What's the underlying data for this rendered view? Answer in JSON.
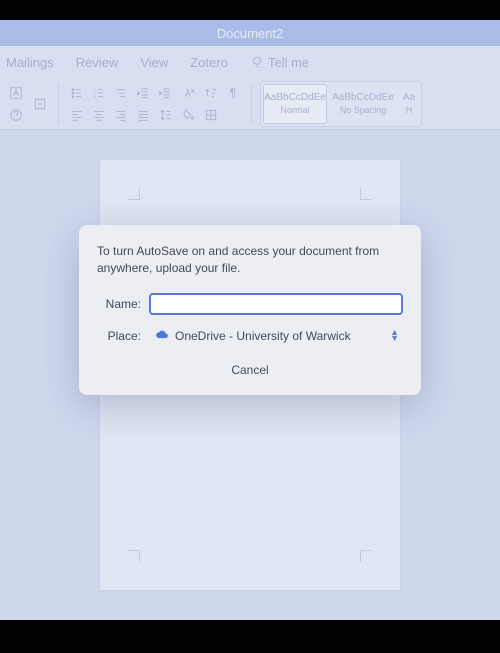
{
  "window": {
    "title": "Document2"
  },
  "ribbon": {
    "tabs": {
      "mailings": "Mailings",
      "review": "Review",
      "view": "View",
      "zotero": "Zotero",
      "tell_me": "Tell me"
    },
    "styles": {
      "normal": {
        "preview": "AaBbCcDdEe",
        "label": "Normal"
      },
      "no_spacing": {
        "preview": "AaBbCcDdEe",
        "label": "No Spacing"
      },
      "heading_cut": {
        "preview": "Aa",
        "label": "H"
      }
    }
  },
  "dialog": {
    "message": "To turn AutoSave on and access your document from anywhere, upload your file.",
    "name_label": "Name:",
    "name_value": "",
    "place_label": "Place:",
    "place_value": "OneDrive - University of Warwick",
    "cancel": "Cancel"
  }
}
